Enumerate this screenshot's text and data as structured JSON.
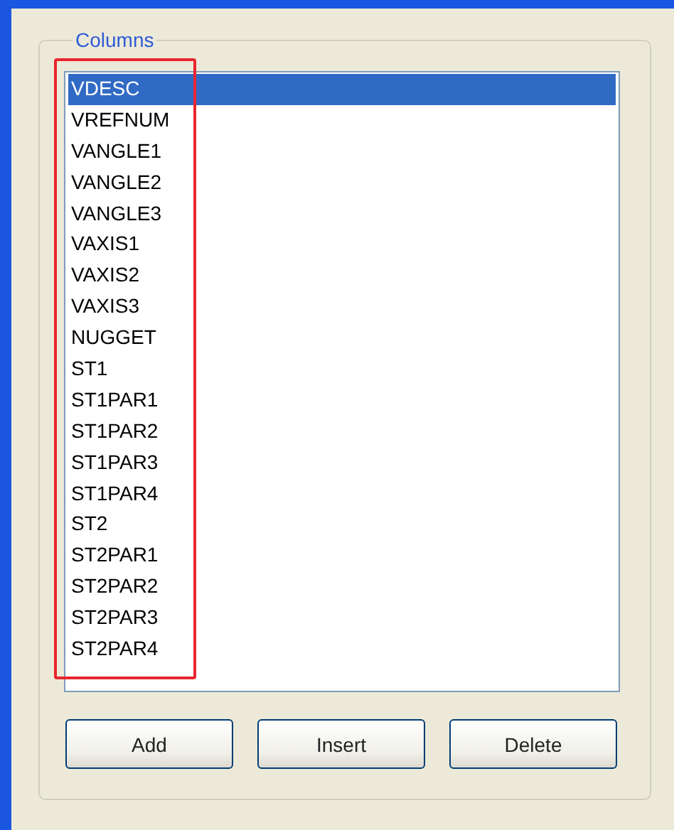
{
  "group": {
    "title": "Columns"
  },
  "list_items": [
    {
      "label": "VDESC",
      "selected": true
    },
    {
      "label": "VREFNUM",
      "selected": false
    },
    {
      "label": "VANGLE1",
      "selected": false
    },
    {
      "label": "VANGLE2",
      "selected": false
    },
    {
      "label": "VANGLE3",
      "selected": false
    },
    {
      "label": "VAXIS1",
      "selected": false
    },
    {
      "label": "VAXIS2",
      "selected": false
    },
    {
      "label": "VAXIS3",
      "selected": false
    },
    {
      "label": "NUGGET",
      "selected": false
    },
    {
      "label": "ST1",
      "selected": false
    },
    {
      "label": "ST1PAR1",
      "selected": false
    },
    {
      "label": "ST1PAR2",
      "selected": false
    },
    {
      "label": "ST1PAR3",
      "selected": false
    },
    {
      "label": "ST1PAR4",
      "selected": false
    },
    {
      "label": "ST2",
      "selected": false
    },
    {
      "label": "ST2PAR1",
      "selected": false
    },
    {
      "label": "ST2PAR2",
      "selected": false
    },
    {
      "label": "ST2PAR3",
      "selected": false
    },
    {
      "label": "ST2PAR4",
      "selected": false
    }
  ],
  "buttons": [
    "Add",
    "Insert",
    "Delete"
  ]
}
